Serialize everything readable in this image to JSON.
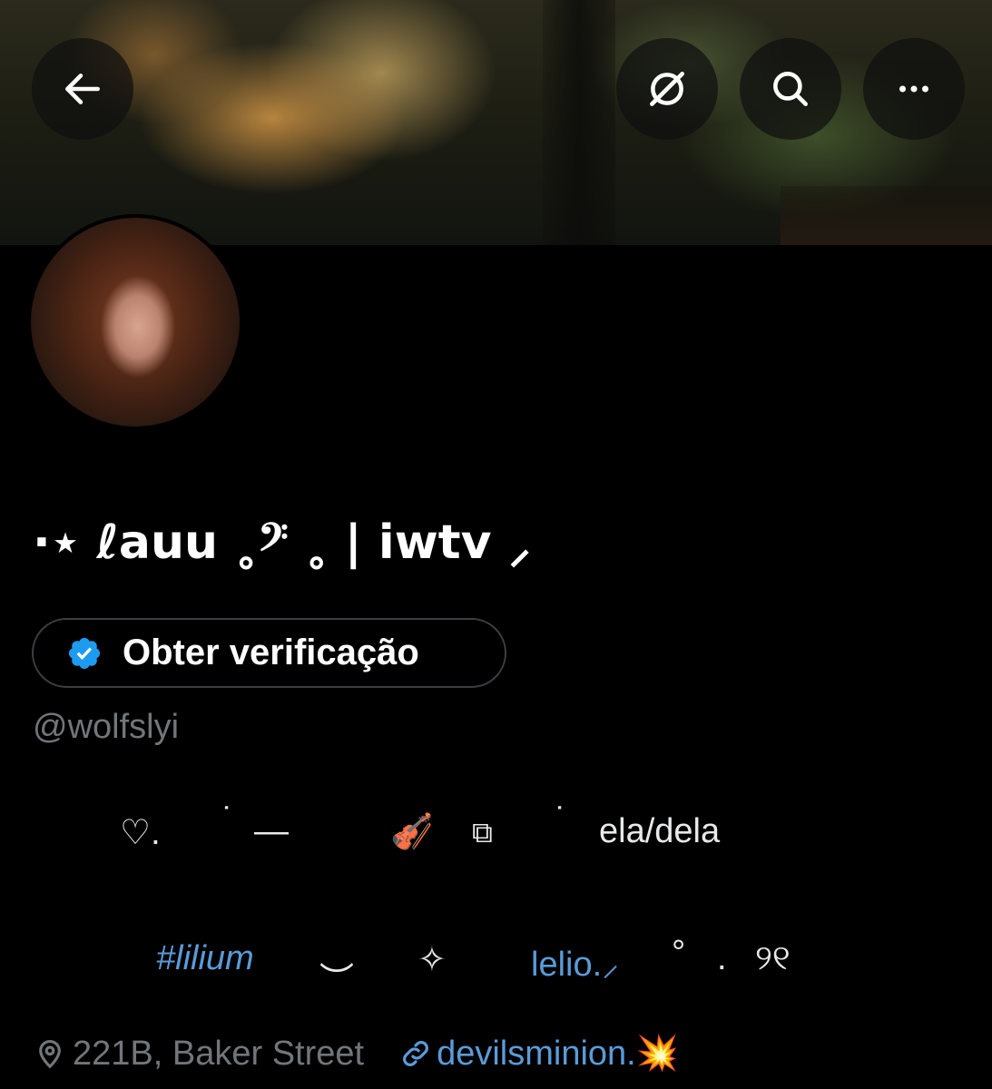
{
  "header": {
    "back_icon": "arrow-left-icon",
    "grok_icon": "grok-icon",
    "search_icon": "search-icon",
    "more_icon": "more-horizontal-icon"
  },
  "profile": {
    "display_name": "·⋆ ℓauu ˳𝄢 ˳ | iwtv ⸝",
    "verify_label": "Obter verificação",
    "handle": "@wolfslyi",
    "bio_line1": {
      "part1": "♡.",
      "part2": "˙",
      "part3": "—",
      "part4": "🎻",
      "part5": "⧉",
      "part6": "˙",
      "part7": "ela/dela"
    },
    "bio_line2": {
      "hashtag": "#lilium",
      "part2": "︶",
      "part3": "✧",
      "mention": "lelio.⸝",
      "part5": "°",
      "part6": ".",
      "part7": "୨୧"
    },
    "location": "221B, Baker Street",
    "website": "devilsminion.💥"
  },
  "colors": {
    "background": "#000000",
    "accent": "#1d9bf0",
    "muted": "#71767b",
    "verified_badge": "#1d9bf0"
  }
}
